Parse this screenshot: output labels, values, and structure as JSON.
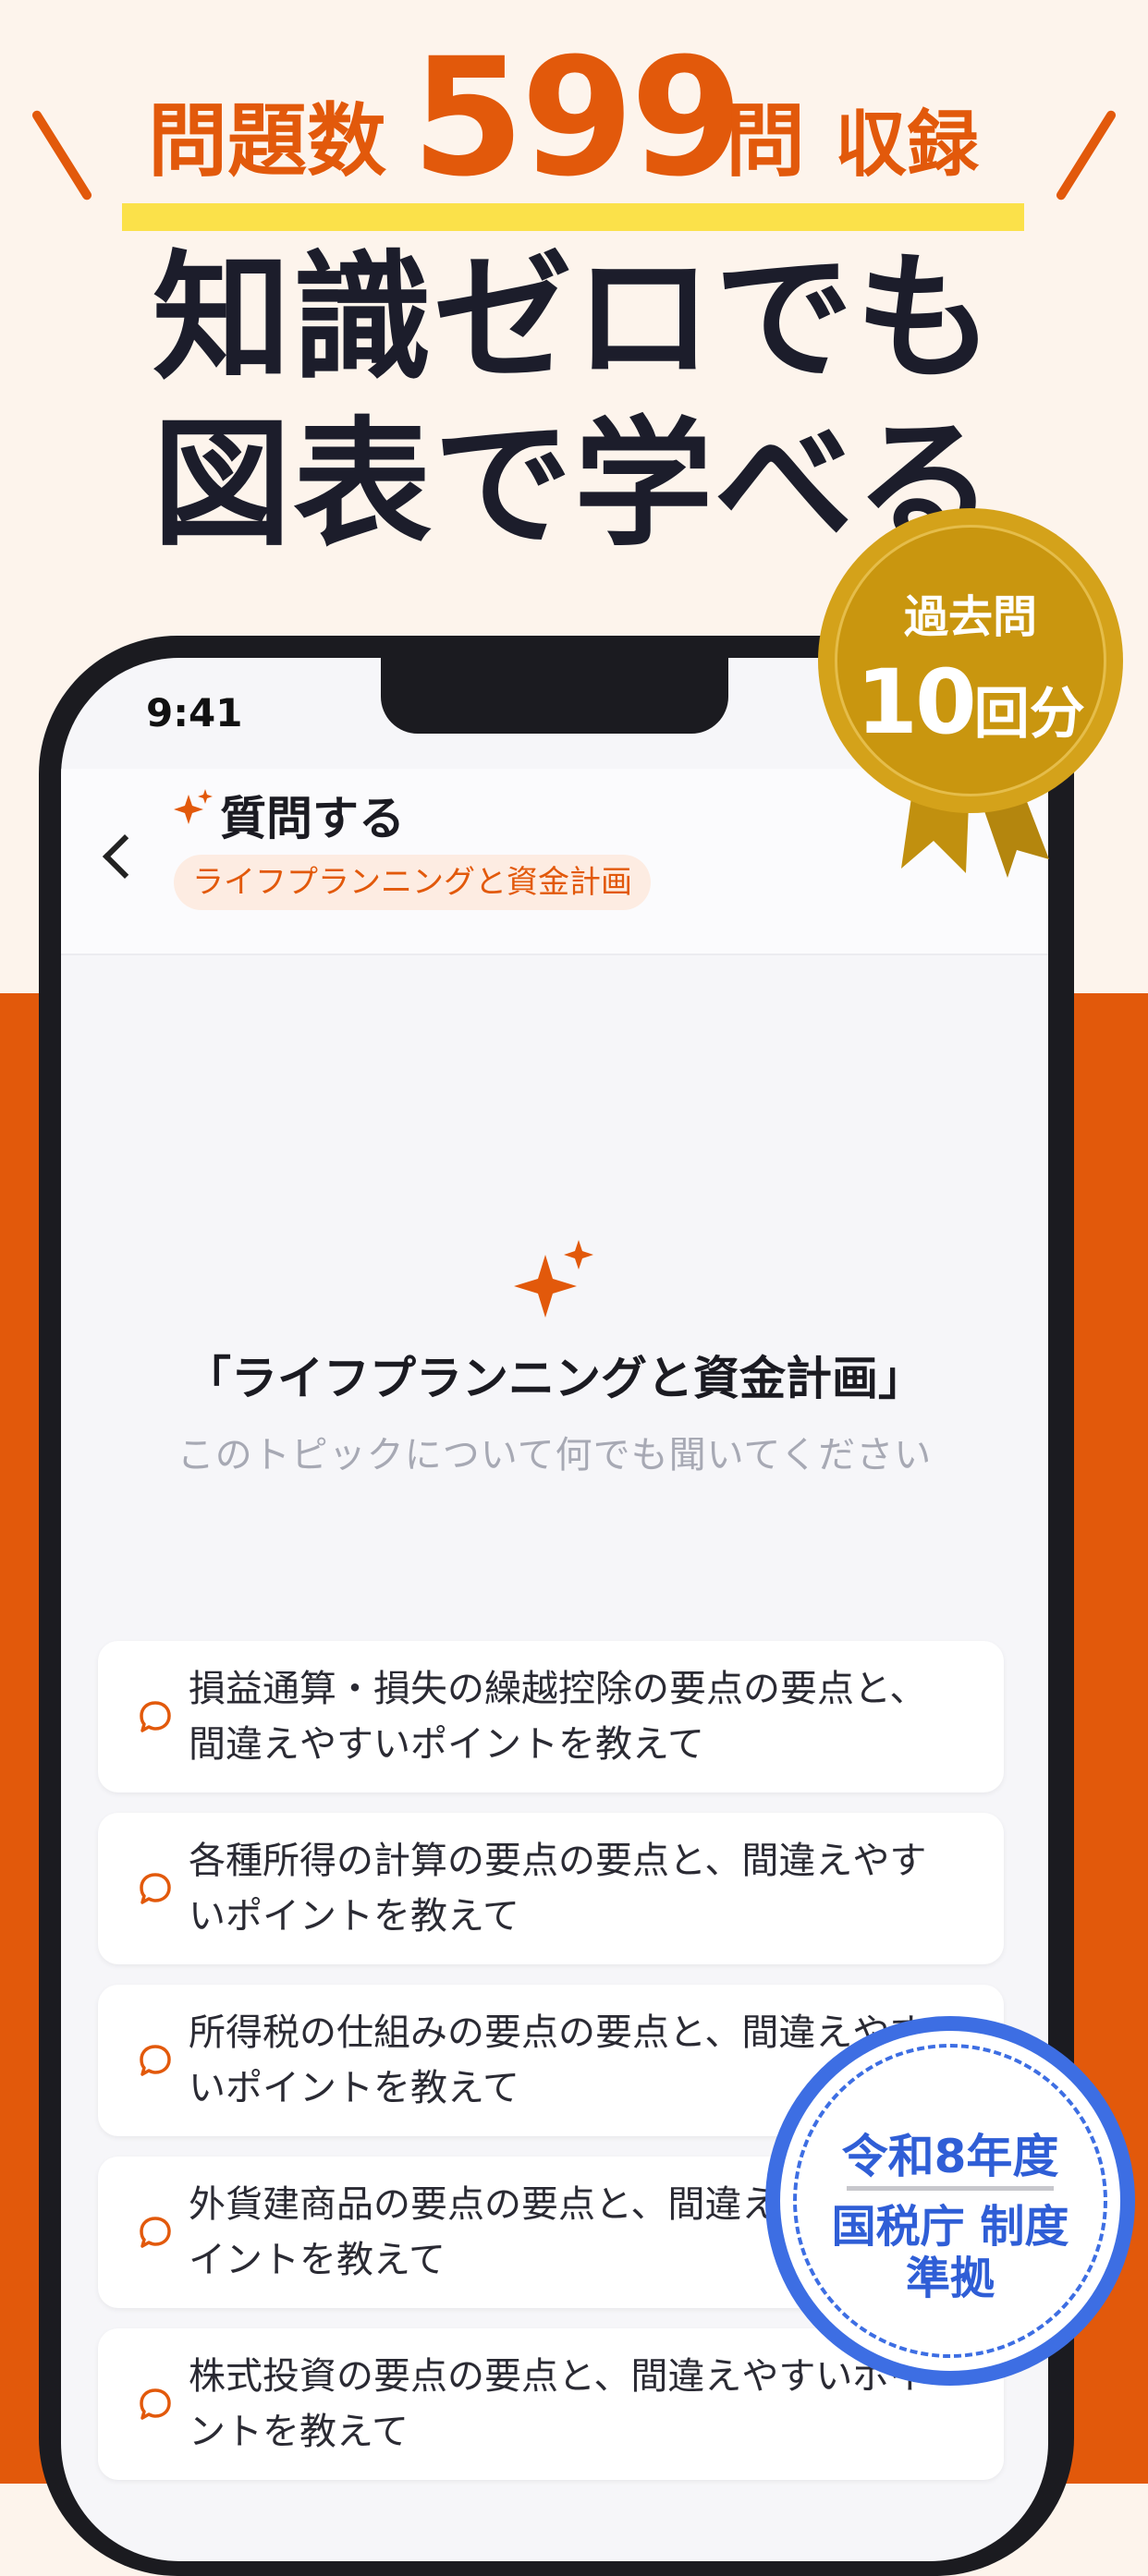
{
  "headline": {
    "prefix": "問題数",
    "count": "599",
    "unit": "問",
    "suffix": "収録",
    "title_line1": "知識ゼロでも",
    "title_line2": "図表で学べる"
  },
  "badge_gold": {
    "line1": "過去問",
    "number": "10",
    "unit": "回分"
  },
  "badge_seal": {
    "line1": "令和8年度",
    "line2": "国税庁 制度",
    "line3": "準拠"
  },
  "status_bar": {
    "time": "9:41"
  },
  "header": {
    "title": "質問する",
    "chip": "ライフプランニングと資金計画"
  },
  "empty_state": {
    "topic": "「ライフプランニングと資金計画」",
    "subtitle": "このトピックについて何でも聞いてください"
  },
  "suggestions": [
    "損益通算・損失の繰越控除の要点の要点と、間違えやすいポイントを教えて",
    "各種所得の計算の要点の要点と、間違えやすいポイントを教えて",
    "所得税の仕組みの要点の要点と、間違えやすいポイントを教えて",
    "外貨建商品の要点の要点と、間違えやすいポイントを教えて",
    "株式投資の要点の要点と、間違えやすいポイントを教えて"
  ],
  "colors": {
    "accent": "#e2590b",
    "gold": "#d4a21a",
    "seal_blue": "#3d6ee3",
    "highlight": "#fbe14a"
  }
}
